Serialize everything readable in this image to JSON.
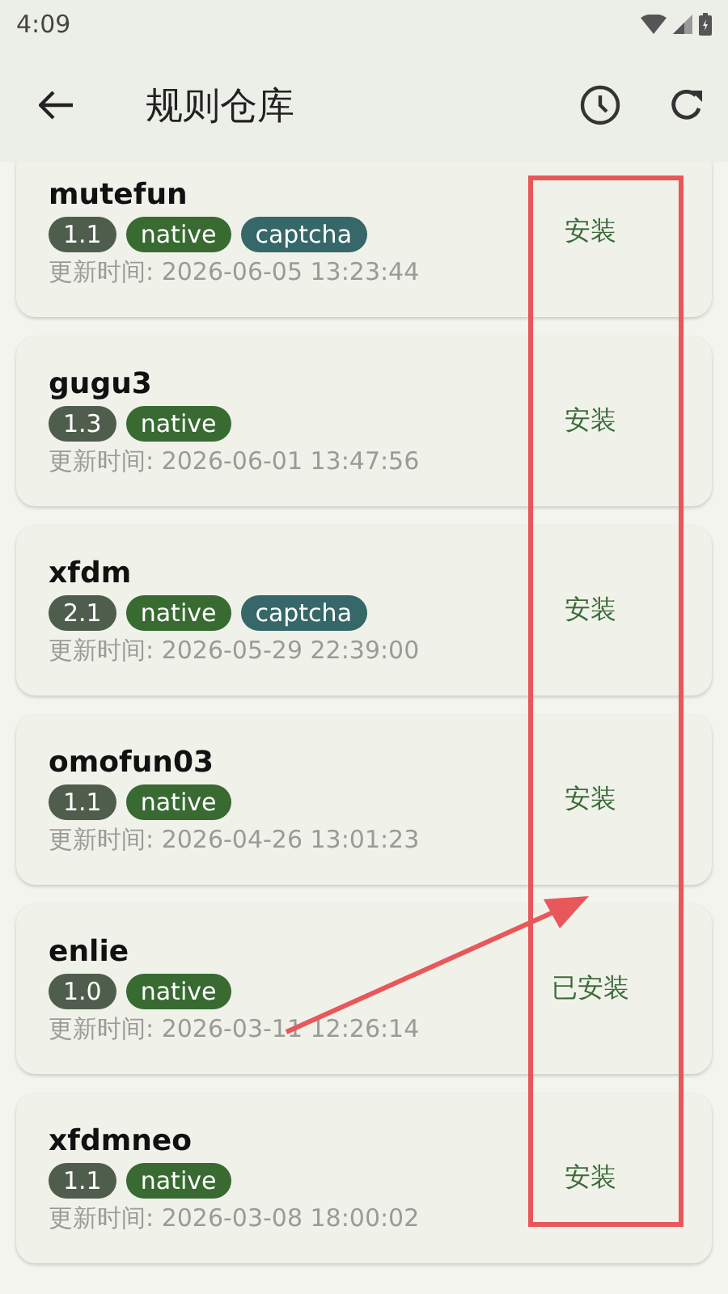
{
  "status_bar": {
    "time": "4:09"
  },
  "app_bar": {
    "title": "规则仓库"
  },
  "rules": [
    {
      "name": "mutefun",
      "tags": [
        {
          "kind": "version",
          "text": "1.1"
        },
        {
          "kind": "native",
          "text": "native"
        },
        {
          "kind": "captcha",
          "text": "captcha"
        }
      ],
      "updated": "更新时间: 2026-06-05 13:23:44",
      "action": "安装"
    },
    {
      "name": "gugu3",
      "tags": [
        {
          "kind": "version",
          "text": "1.3"
        },
        {
          "kind": "native",
          "text": "native"
        }
      ],
      "updated": "更新时间: 2026-06-01 13:47:56",
      "action": "安装"
    },
    {
      "name": "xfdm",
      "tags": [
        {
          "kind": "version",
          "text": "2.1"
        },
        {
          "kind": "native",
          "text": "native"
        },
        {
          "kind": "captcha",
          "text": "captcha"
        }
      ],
      "updated": "更新时间: 2026-05-29 22:39:00",
      "action": "安装"
    },
    {
      "name": "omofun03",
      "tags": [
        {
          "kind": "version",
          "text": "1.1"
        },
        {
          "kind": "native",
          "text": "native"
        }
      ],
      "updated": "更新时间: 2026-04-26 13:01:23",
      "action": "安装"
    },
    {
      "name": "enlie",
      "tags": [
        {
          "kind": "version",
          "text": "1.0"
        },
        {
          "kind": "native",
          "text": "native"
        }
      ],
      "updated": "更新时间: 2026-03-11 12:26:14",
      "action": "已安装"
    },
    {
      "name": "xfdmneo",
      "tags": [
        {
          "kind": "version",
          "text": "1.1"
        },
        {
          "kind": "native",
          "text": "native"
        }
      ],
      "updated": "更新时间: 2026-03-08 18:00:02",
      "action": "安装"
    }
  ]
}
